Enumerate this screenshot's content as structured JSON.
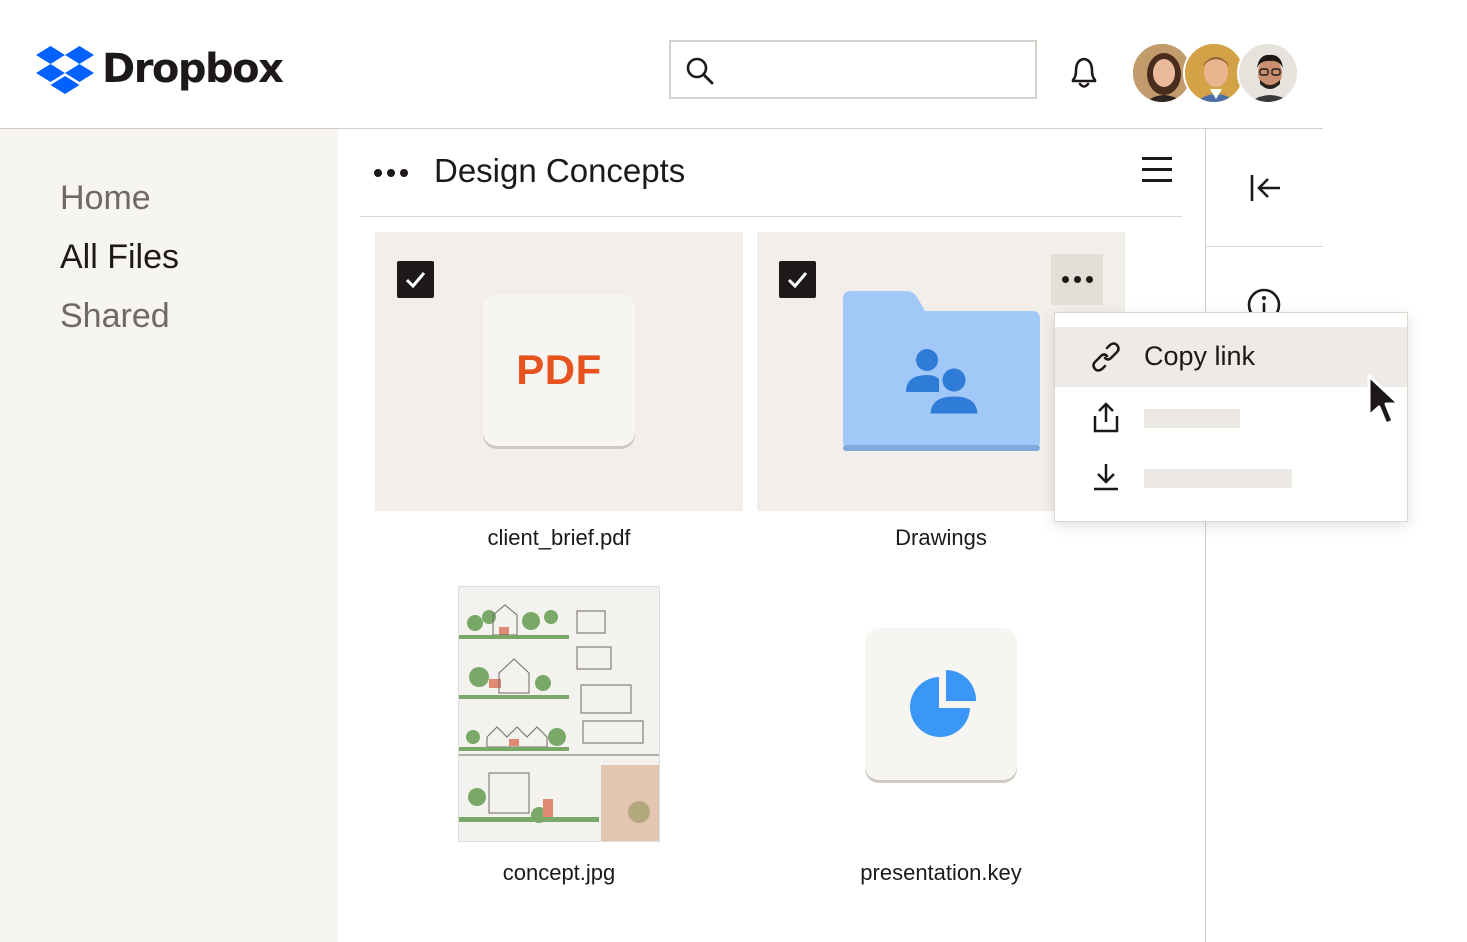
{
  "app": {
    "name": "Dropbox",
    "brand_color": "#0061fe"
  },
  "header": {
    "search": {
      "value": "",
      "placeholder": "",
      "icon": "search-icon"
    },
    "notifications_icon": "bell-icon",
    "avatars": [
      "avatar-1",
      "avatar-2",
      "avatar-3"
    ]
  },
  "sidebar": {
    "items": [
      {
        "label": "Home",
        "active": false
      },
      {
        "label": "All Files",
        "active": true
      },
      {
        "label": "Shared",
        "active": false
      }
    ]
  },
  "main": {
    "folder_title": "Design Concepts",
    "files": [
      {
        "name": "client_brief.pdf",
        "type_badge": "PDF",
        "selected": true
      },
      {
        "name": "Drawings",
        "type": "shared folder",
        "selected": true
      },
      {
        "name": "concept.jpg",
        "type": "image"
      },
      {
        "name": "presentation.key",
        "type": "keynote"
      }
    ]
  },
  "context_menu": {
    "items": [
      {
        "label": "Copy link",
        "icon": "link-icon"
      },
      {
        "label": "",
        "icon": "share-icon"
      },
      {
        "label": "",
        "icon": "download-icon"
      }
    ]
  },
  "colors": {
    "pdf_red": "#e7531e",
    "folder_blue": "#a2c8f7",
    "folder_people": "#2f7bd8",
    "keynote_blue": "#3a97f5",
    "sidebar_bg": "#f7f5f2",
    "tile_bg": "#f2efeb"
  }
}
